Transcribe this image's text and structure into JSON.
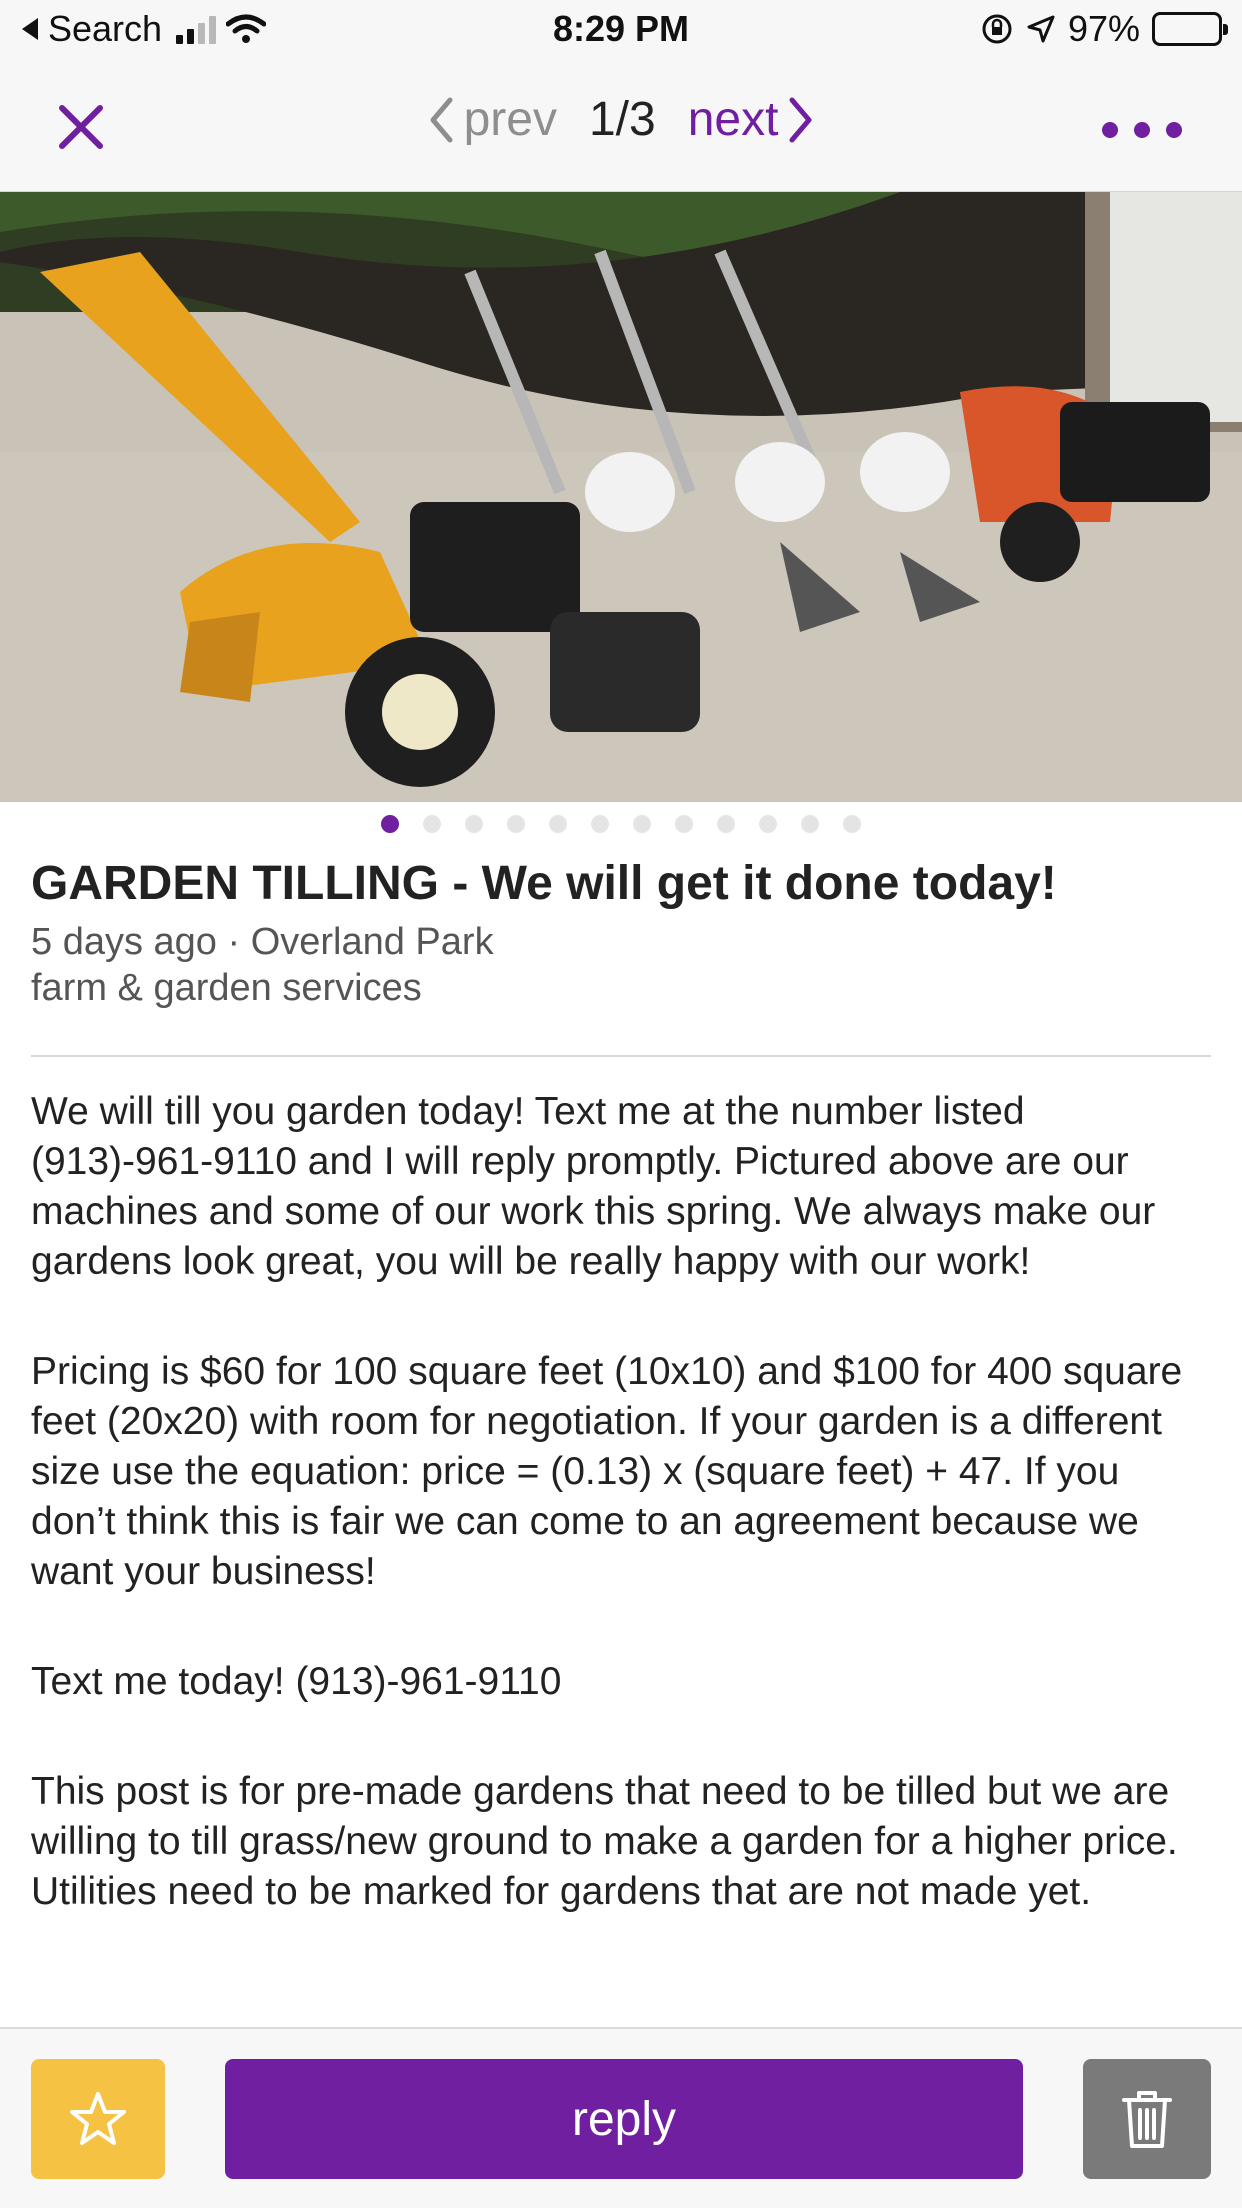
{
  "status_bar": {
    "back_app": "Search",
    "time": "8:29 PM",
    "battery": "97%"
  },
  "nav": {
    "prev_label": "prev",
    "counter": "1/3",
    "next_label": "next"
  },
  "photo": {
    "total": 12,
    "active_index": 0
  },
  "post": {
    "title": "GARDEN TILLING - We will get it done today!",
    "meta": "5 days ago · Overland Park",
    "category": "farm & garden services",
    "body": [
      "We will till you garden today! Text me at the number listed (913)-961-9110 and I will reply promptly. Pictured above are our machines and some of our work this spring. We always make our gardens look great, you will be really happy with our work!",
      "Pricing is $60 for 100 square feet (10x10) and $100 for 400 square feet (20x20) with room for negotiation. If your garden is a different size use the equation: price = (0.13) x (square feet) + 47. If you don’t think this is fair we can come to an agreement because we want your business!",
      "Text me today! (913)-961-9110",
      "This post is for pre-made gardens that need to be tilled but we are willing to till grass/new ground to make a garden for a higher price. Utilities need to be marked for gardens that are not made yet."
    ]
  },
  "actions": {
    "reply_label": "reply"
  },
  "colors": {
    "accent": "#6f1f9f",
    "favorite": "#f6c244",
    "delete": "#7a7a7a"
  }
}
